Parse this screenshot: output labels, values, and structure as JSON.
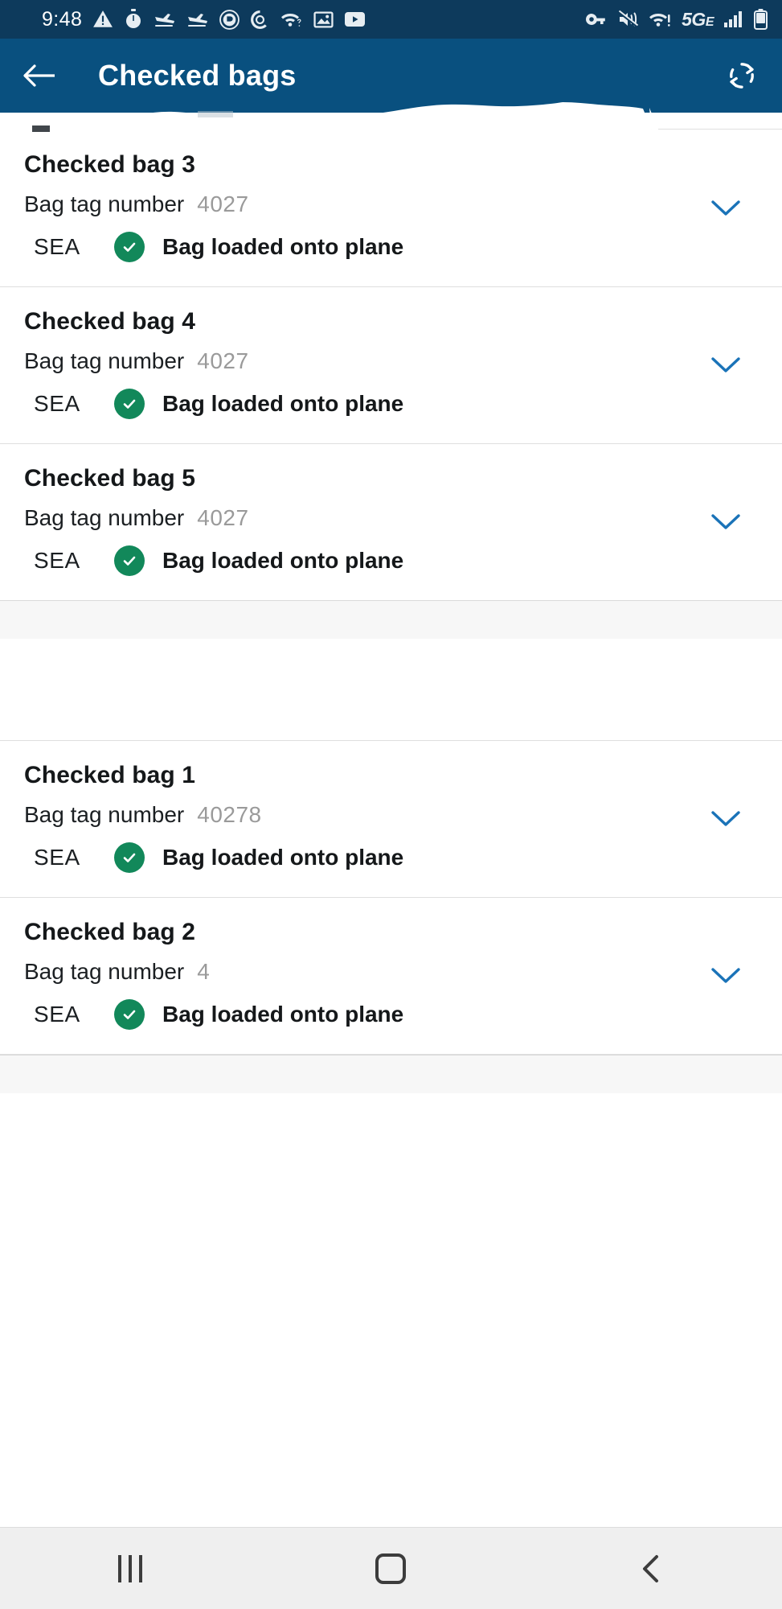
{
  "status_bar": {
    "time": "9:48",
    "left_icons": [
      "warning-triangle-icon",
      "stopwatch-icon",
      "flight-arrival-icon",
      "flight-arrival-icon",
      "coin-circle-icon",
      "ring-circle-icon",
      "wifi-question-icon",
      "photo-icon",
      "video-play-icon"
    ],
    "right_icons": [
      "vpn-key-icon",
      "volume-vibrate-icon",
      "wifi-alert-icon",
      "network-5ge-icon",
      "signal-bars-icon",
      "battery-icon"
    ],
    "network_label": "5G",
    "network_sublabel": "E",
    "background": "#0d3a5c"
  },
  "header": {
    "back_label": "Back",
    "title": "Checked bags",
    "refresh_label": "Refresh",
    "background": "#09507f",
    "text_color": "#ffffff"
  },
  "labels": {
    "bag_tag_label": "Bag tag number",
    "chevron_label": "Expand",
    "accent_blue": "#1a73b8",
    "status_green": "#12885a"
  },
  "groups": [
    {
      "id": "group-top",
      "bags": [
        {
          "title": "Checked bag 3",
          "tag_label": "Bag tag number",
          "tag_value": "4027",
          "airport": "SEA",
          "status": "Bag loaded onto plane",
          "status_icon": "check-circle-icon"
        },
        {
          "title": "Checked bag 4",
          "tag_label": "Bag tag number",
          "tag_value": "4027",
          "airport": "SEA",
          "status": "Bag loaded onto plane",
          "status_icon": "check-circle-icon"
        },
        {
          "title": "Checked bag 5",
          "tag_label": "Bag tag number",
          "tag_value": "4027",
          "airport": "SEA",
          "status": "Bag loaded onto plane",
          "status_icon": "check-circle-icon"
        }
      ]
    },
    {
      "id": "group-bottom",
      "bags": [
        {
          "title": "Checked bag 1",
          "tag_label": "Bag tag number",
          "tag_value": "40278",
          "airport": "SEA",
          "status": "Bag loaded onto plane",
          "status_icon": "check-circle-icon"
        },
        {
          "title": "Checked bag 2",
          "tag_label": "Bag tag number",
          "tag_value": "4",
          "airport": "SEA",
          "status": "Bag loaded onto plane",
          "status_icon": "check-circle-icon"
        }
      ]
    }
  ],
  "nav_bar": {
    "recents_label": "Recent apps",
    "home_label": "Home",
    "back_label": "Back",
    "background": "#efefef"
  }
}
